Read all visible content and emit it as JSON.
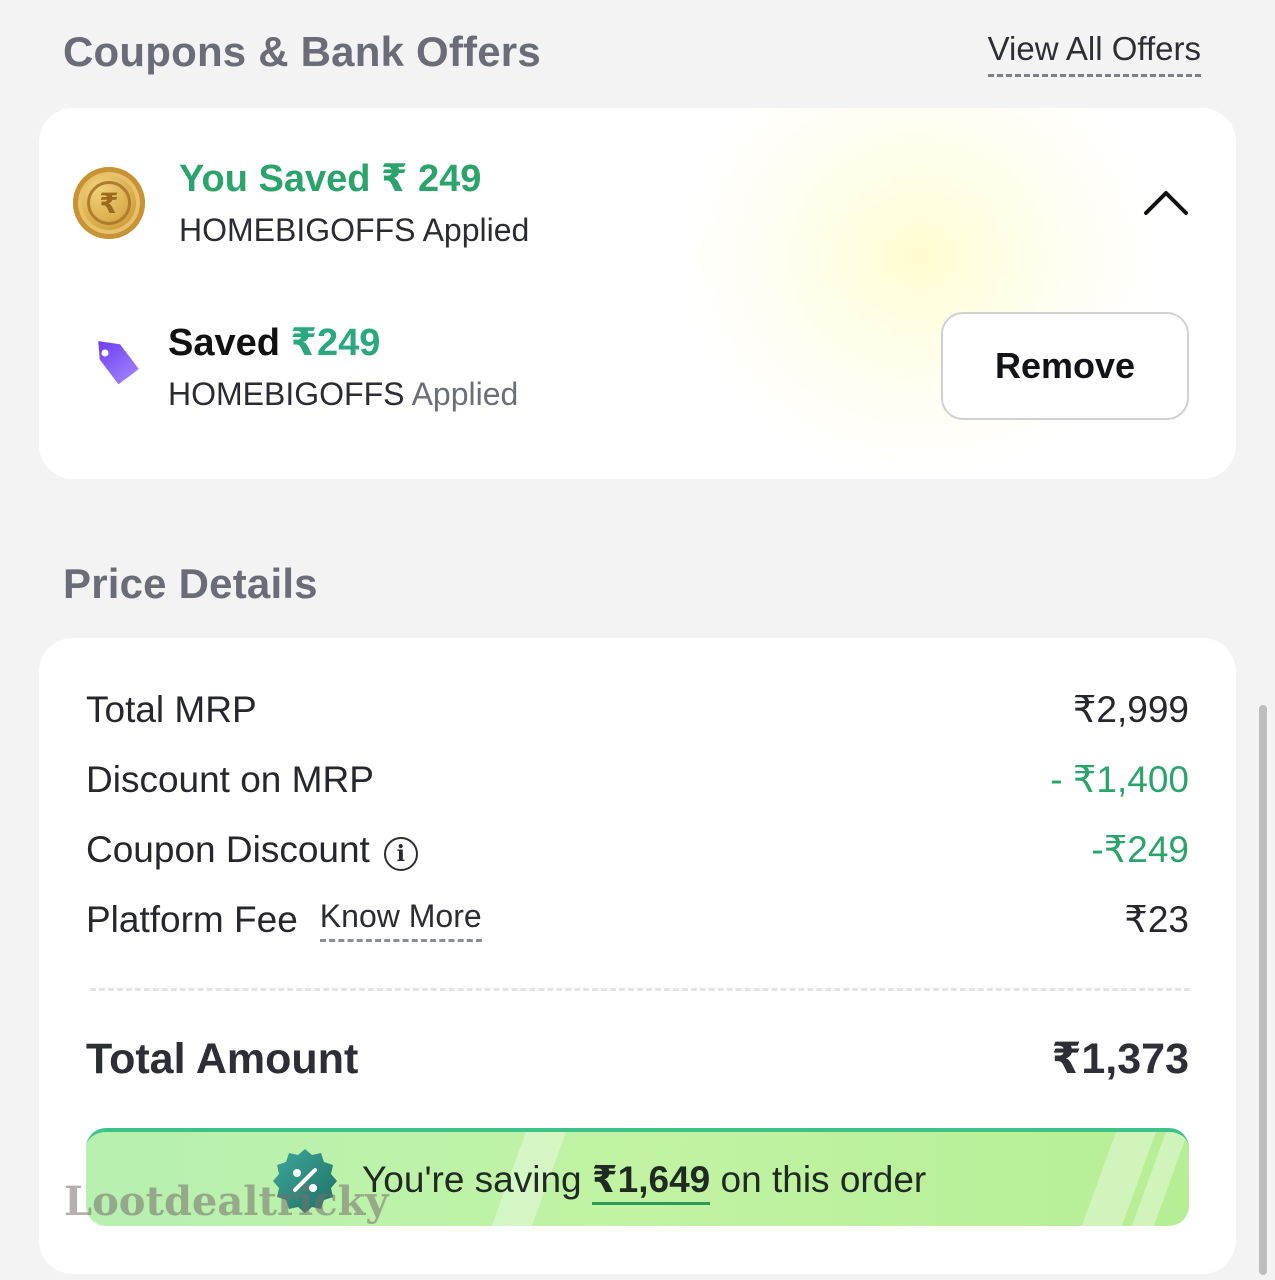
{
  "coupons_section": {
    "title": "Coupons & Bank Offers",
    "view_all_label": "View All Offers"
  },
  "coupon_card": {
    "saved_text": "You Saved ₹ 249",
    "applied_text": "HOMEBIGOFFS Applied",
    "coin_symbol": "₹",
    "applied_coupon": {
      "saved_label": "Saved",
      "saved_amount": "₹249",
      "code": "HOMEBIGOFFS",
      "applied_label": "Applied",
      "remove_label": "Remove"
    }
  },
  "price_section": {
    "title": "Price Details",
    "rows": [
      {
        "label": "Total MRP",
        "value": "₹2,999"
      },
      {
        "label": "Discount on MRP",
        "value": "- ₹1,400"
      },
      {
        "label": "Coupon Discount",
        "value": "-₹249"
      },
      {
        "label": "Platform Fee",
        "link": "Know More",
        "value": "₹23"
      }
    ],
    "total_label": "Total Amount",
    "total_value": "₹1,373",
    "saving_banner": {
      "prefix": "You're saving",
      "amount": "₹1,649",
      "suffix": "on this order"
    }
  },
  "watermark": "Lootdealtricky",
  "colors": {
    "green_text": "#2aa46a",
    "tag_purple": "#7c4dff",
    "banner_green": "#b7f0b0"
  },
  "icons": {
    "coin": "rupee-coin-icon",
    "collapse": "chevron-up-icon",
    "tag": "price-tag-icon",
    "info": "info-icon",
    "badge": "discount-badge-icon"
  }
}
